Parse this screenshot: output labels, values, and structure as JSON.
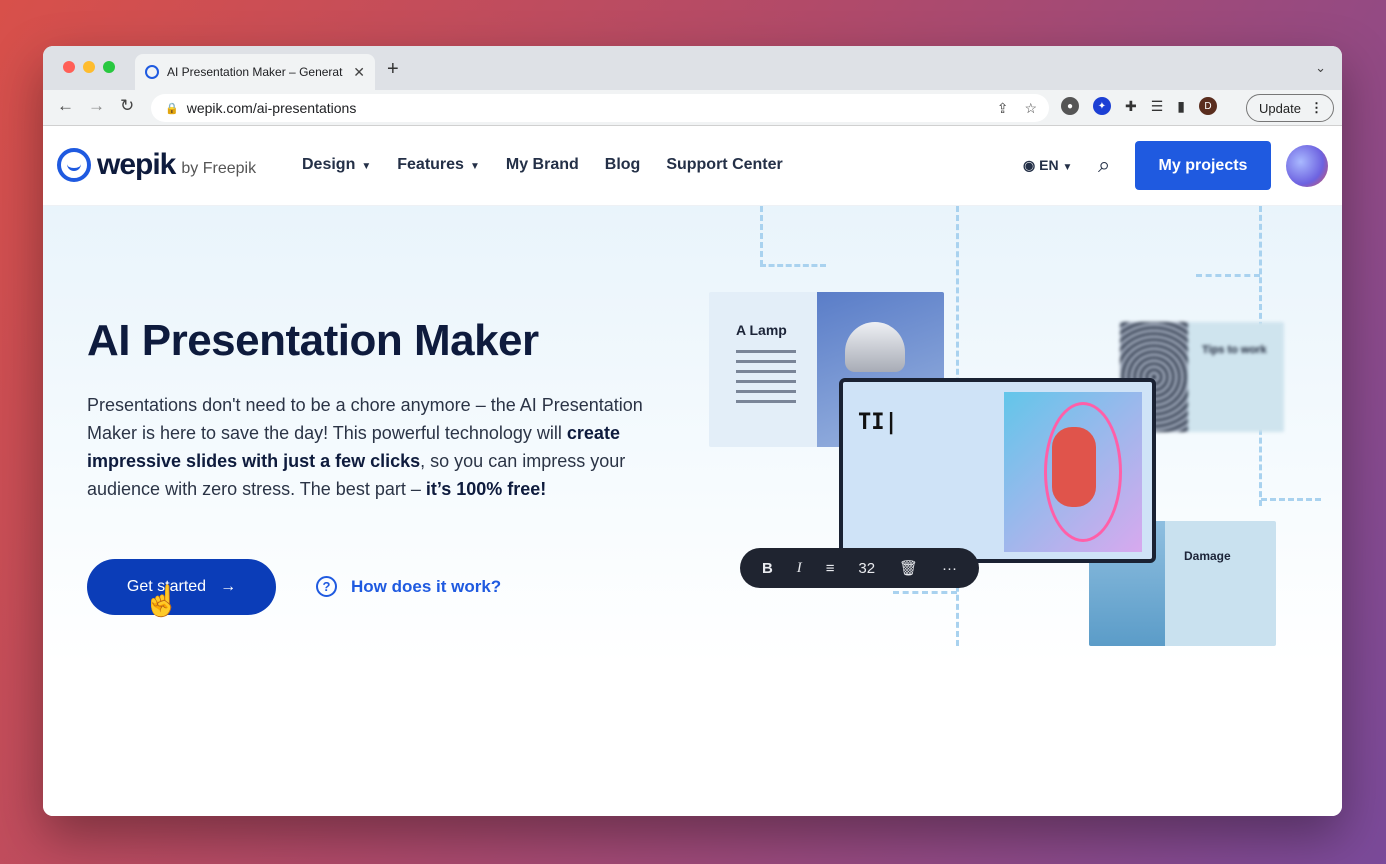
{
  "browser": {
    "tab_title": "AI Presentation Maker – Generat",
    "url": "wepik.com/ai-presentations",
    "update_label": "Update",
    "profile_initial": "D"
  },
  "site": {
    "logo_name": "wepik",
    "logo_by": "by Freepik",
    "nav": [
      {
        "label": "Design",
        "has_menu": true
      },
      {
        "label": "Features",
        "has_menu": true
      },
      {
        "label": "My Brand",
        "has_menu": false
      },
      {
        "label": "Blog",
        "has_menu": false
      },
      {
        "label": "Support Center",
        "has_menu": false
      }
    ],
    "language": "EN",
    "my_projects": "My projects"
  },
  "hero": {
    "title": "AI Presentation Maker",
    "desc_part1": "Presentations don't need to be a chore anymore – the AI Presentation Maker is here to save the day! This powerful technology will ",
    "desc_bold1": "create impressive slides with just a few clicks",
    "desc_part2": ", so you can impress your audience with zero stress. The best part – ",
    "desc_bold2": "it’s 100% free!",
    "cta_label": "Get started",
    "help_label": "How does it work?"
  },
  "illustration": {
    "lamp_title": "A Lamp",
    "tips_title": "Tips to work",
    "damage_title": "Damage",
    "editor_text": "TI",
    "toolbar": {
      "bold": "B",
      "italic": "I",
      "font_size": "32"
    }
  }
}
